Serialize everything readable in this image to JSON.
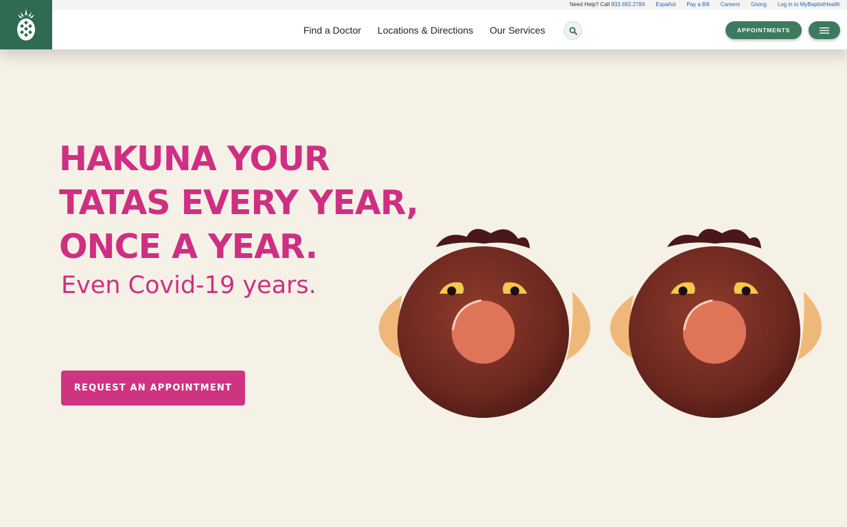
{
  "utility": {
    "help_prefix": "Need Help? Call",
    "phone": "833.692.2784",
    "links": [
      "Español",
      "Pay a Bill",
      "Careers",
      "Giving",
      "Log in to MyBaptistHealth"
    ]
  },
  "header": {
    "logo_icon": "pineapple-logo",
    "nav": [
      "Find a Doctor",
      "Locations & Directions",
      "Our Services"
    ],
    "search_icon": "search-icon",
    "appointments_label": "APPOINTMENTS",
    "menu_icon": "hamburger-icon"
  },
  "hero": {
    "headline": [
      "HAKUNA YOUR",
      "TATAS EVERY YEAR,",
      "ONCE A YEAR."
    ],
    "subhead": "Even Covid-19 years.",
    "cta_label": "REQUEST AN APPOINTMENT",
    "illustration": "two-warthog-faces"
  },
  "colors": {
    "brand_green": "#2f6b52",
    "button_green": "#3d7a5f",
    "accent_pink": "#cf2f83",
    "background": "#f5f1e6"
  }
}
